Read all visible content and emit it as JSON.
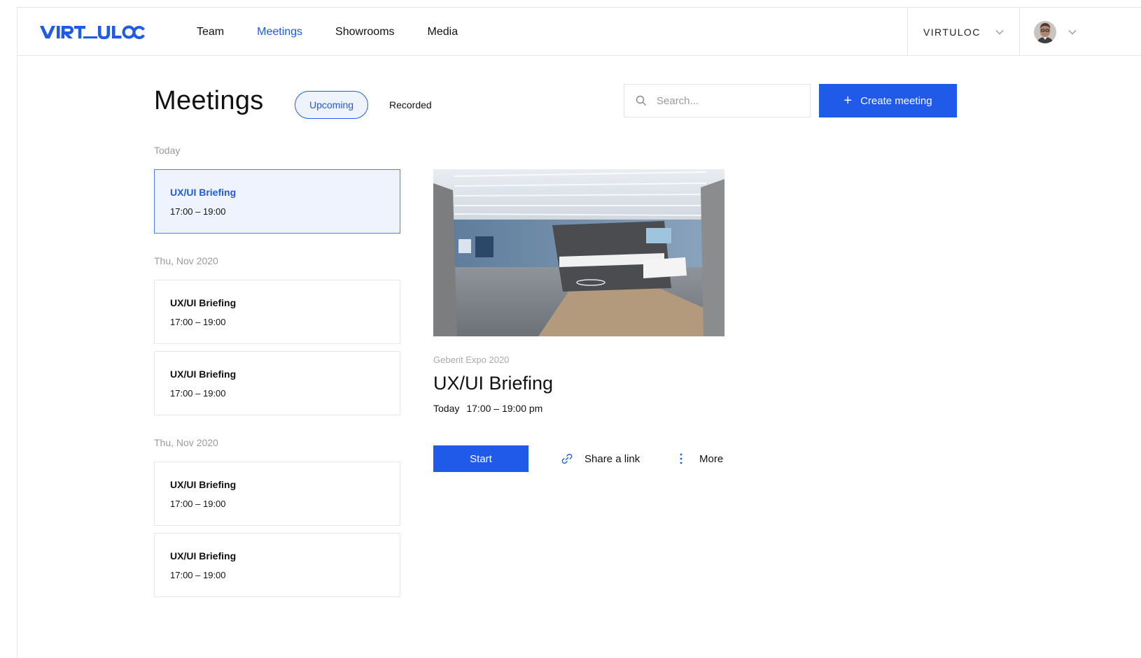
{
  "header": {
    "logo_text": "VIRTULOC",
    "nav": [
      {
        "label": "Team",
        "active": false
      },
      {
        "label": "Meetings",
        "active": true
      },
      {
        "label": "Showrooms",
        "active": false
      },
      {
        "label": "Media",
        "active": false
      }
    ],
    "org_switcher": {
      "label": "VIRTULOC",
      "icon": "chevron-down-icon"
    },
    "user_menu": {
      "icon": "chevron-down-icon"
    }
  },
  "page": {
    "title": "Meetings",
    "tabs": [
      {
        "label": "Upcoming",
        "active": true
      },
      {
        "label": "Recorded",
        "active": false
      }
    ],
    "search": {
      "placeholder": "Search...",
      "value": "",
      "icon": "search-icon"
    },
    "create_button": {
      "label": "Create meeting",
      "icon": "plus-icon"
    }
  },
  "meeting_groups": [
    {
      "label": "Today",
      "meetings": [
        {
          "title": "UX/UI Briefing",
          "time": "17:00 – 19:00",
          "selected": true
        }
      ]
    },
    {
      "label": "Thu, Nov 2020",
      "meetings": [
        {
          "title": "UX/UI Briefing",
          "time": "17:00 – 19:00",
          "selected": false
        },
        {
          "title": "UX/UI Briefing",
          "time": "17:00 – 19:00",
          "selected": false
        }
      ]
    },
    {
      "label": "Thu, Nov 2020",
      "meetings": [
        {
          "title": "UX/UI Briefing",
          "time": "17:00 – 19:00",
          "selected": false
        },
        {
          "title": "UX/UI Briefing",
          "time": "17:00 – 19:00",
          "selected": false
        }
      ]
    }
  ],
  "detail": {
    "venue": "Geberit Expo 2020",
    "title": "UX/UI Briefing",
    "day": "Today",
    "time": "17:00 – 19:00 pm",
    "start_label": "Start",
    "share_label": "Share a link",
    "share_icon": "link-icon",
    "more_label": "More",
    "more_icon": "more-vertical-icon"
  },
  "colors": {
    "accent": "#1f5ae8",
    "selected_bg": "#eef3fe",
    "muted_text": "#9a9a9a",
    "border": "#e6e6e6"
  }
}
